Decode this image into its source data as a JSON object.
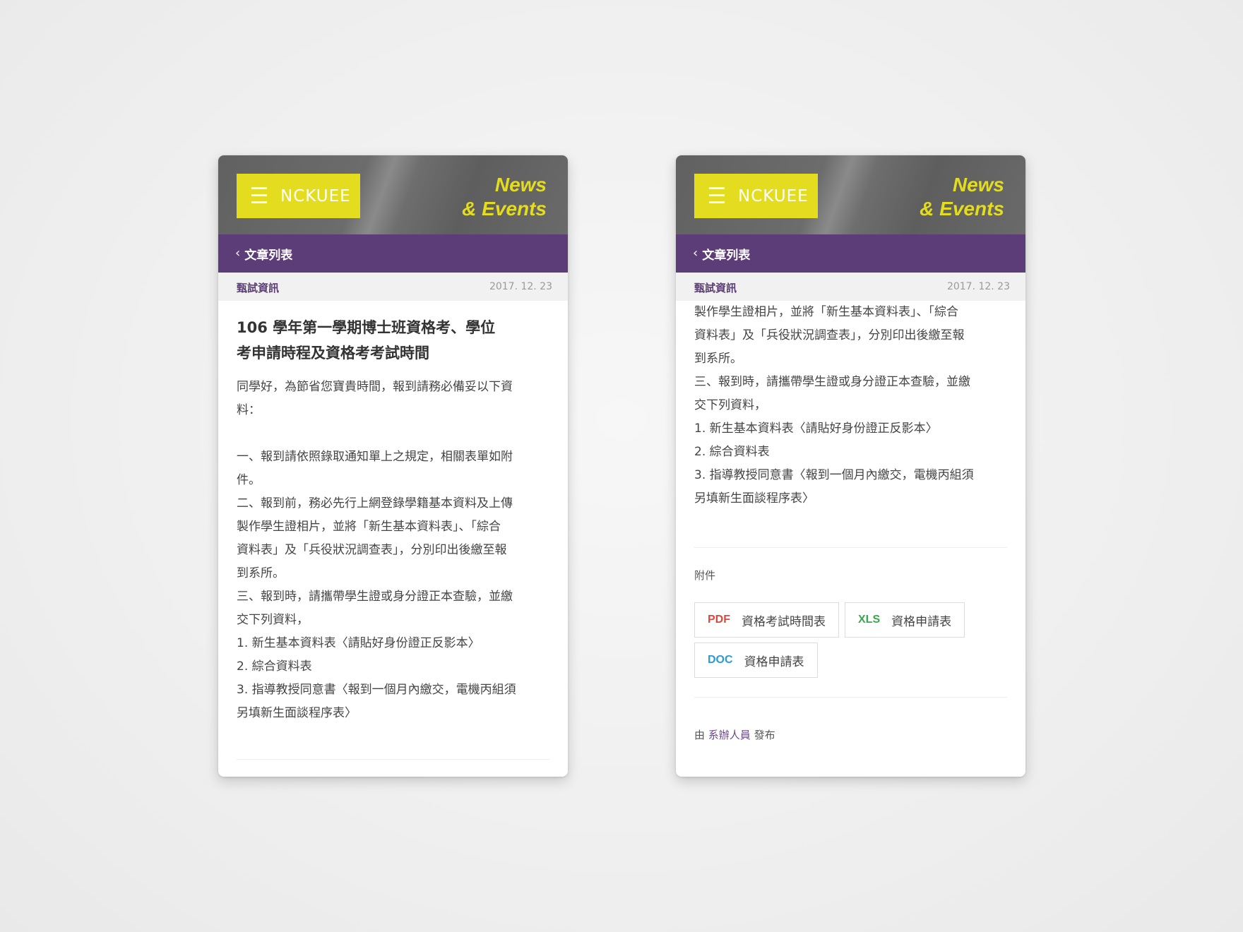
{
  "header": {
    "logo_text": "NCKUEE",
    "section_line1": "News",
    "section_line2": "& Events"
  },
  "nav": {
    "back_label": "文章列表"
  },
  "meta": {
    "category": "甄試資訊",
    "date": "2017. 12. 23"
  },
  "article": {
    "title_line1": "106 學年第一學期博士班資格考、學位",
    "title_line2": "考申請時程及資格考考試時間",
    "left_lines": [
      "同學好，為節省您寶貴時間，報到請務必備妥以下資",
      "料：",
      "",
      "一、報到請依照錄取通知單上之規定，相關表單如附",
      "件。",
      "二、報到前，務必先行上網登錄學籍基本資料及上傳",
      "製作學生證相片，並將「新生基本資料表」、「綜合",
      "資料表」及「兵役狀況調查表」，分別印出後繳至報",
      "到系所。",
      "三、報到時，請攜帶學生證或身分證正本查驗，並繳",
      "交下列資料，",
      "1. 新生基本資料表〈請貼好身份證正反影本〉",
      "2. 綜合資料表",
      "3. 指導教授同意書〈報到一個月內繳交，電機丙組須",
      "另填新生面談程序表〉"
    ],
    "right_lines": [
      "製作學生證相片，並將「新生基本資料表」、「綜合",
      "資料表」及「兵役狀況調查表」，分別印出後繳至報",
      "到系所。",
      "三、報到時，請攜帶學生證或身分證正本查驗，並繳",
      "交下列資料，",
      "1. 新生基本資料表〈請貼好身份證正反影本〉",
      "2. 綜合資料表",
      "3. 指導教授同意書〈報到一個月內繳交，電機丙組須",
      "另填新生面談程序表〉"
    ]
  },
  "attachments": {
    "label": "附件",
    "items": [
      {
        "type": "PDF",
        "name": "資格考試時間表",
        "color": "#e0463a"
      },
      {
        "type": "XLS",
        "name": "資格申請表",
        "color": "#3aa84a"
      },
      {
        "type": "DOC",
        "name": "資格申請表",
        "color": "#2a9bd6"
      }
    ]
  },
  "footer": {
    "prefix": "由",
    "author": "系辦人員",
    "suffix": "發布"
  },
  "colors": {
    "accent_yellow": "#e4dc1f",
    "brand_purple": "#5d3d78",
    "header_gray": "#6a6a6a"
  }
}
